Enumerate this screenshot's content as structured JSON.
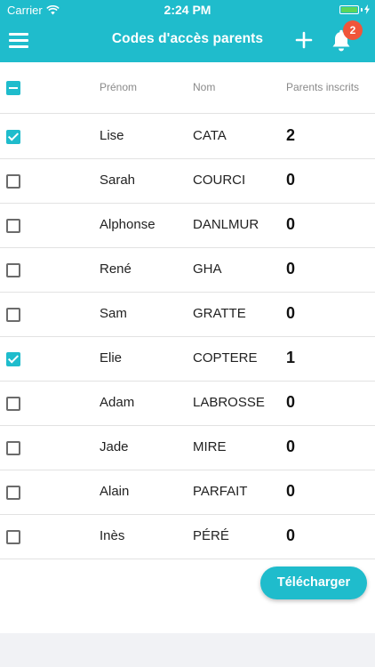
{
  "status_bar": {
    "carrier": "Carrier",
    "time": "2:24 PM"
  },
  "header": {
    "title": "Codes d'accès parents",
    "notification_count": "2"
  },
  "table": {
    "columns": {
      "first_name": "Prénom",
      "last_name": "Nom",
      "parents": "Parents inscrits"
    },
    "select_all": "indeterminate",
    "rows": [
      {
        "first": "Lise",
        "last": "CATA",
        "count": "2",
        "checked": true
      },
      {
        "first": "Sarah",
        "last": "COURCI",
        "count": "0",
        "checked": false
      },
      {
        "first": "Alphonse",
        "last": "DANLMUR",
        "count": "0",
        "checked": false
      },
      {
        "first": "René",
        "last": "GHA",
        "count": "0",
        "checked": false
      },
      {
        "first": "Sam",
        "last": "GRATTE",
        "count": "0",
        "checked": false
      },
      {
        "first": "Elie",
        "last": "COPTERE",
        "count": "1",
        "checked": true
      },
      {
        "first": "Adam",
        "last": "LABROSSE",
        "count": "0",
        "checked": false
      },
      {
        "first": "Jade",
        "last": "MIRE",
        "count": "0",
        "checked": false
      },
      {
        "first": "Alain",
        "last": "PARFAIT",
        "count": "0",
        "checked": false
      },
      {
        "first": "Inès",
        "last": "PÉRÉ",
        "count": "0",
        "checked": false
      }
    ]
  },
  "actions": {
    "download_label": "Télécharger"
  },
  "colors": {
    "accent": "#1fbccc",
    "badge": "#f0553a",
    "battery": "#5bd55b"
  },
  "icons": {
    "menu": "hamburger-menu-icon",
    "add": "plus-icon",
    "bell": "bell-icon",
    "wifi": "wifi-icon",
    "battery": "battery-icon",
    "charging": "charging-bolt-icon"
  }
}
